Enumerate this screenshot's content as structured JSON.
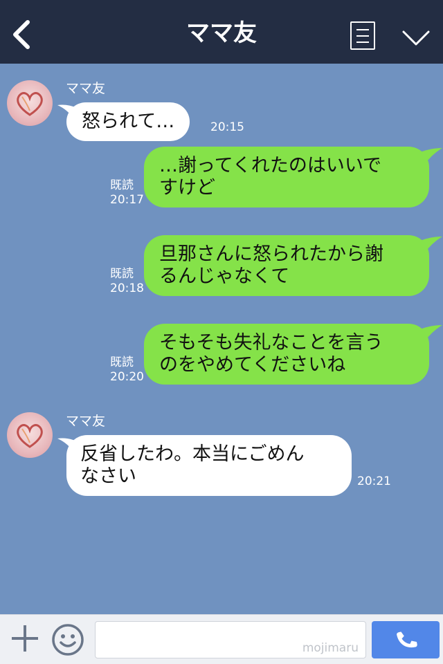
{
  "header": {
    "title": "ママ友"
  },
  "messages": [
    {
      "sender": "ママ友",
      "text": "怒られて…",
      "time": "20:15"
    },
    {
      "text": "…謝ってくれたのはいいで\nすけど",
      "read": "既読",
      "time": "20:17"
    },
    {
      "text": "旦那さんに怒られたから謝\nるんじゃなくて",
      "read": "既読",
      "time": "20:18"
    },
    {
      "text": "そもそも失礼なことを言う\nのをやめてくださいね",
      "read": "既読",
      "time": "20:20"
    },
    {
      "sender": "ママ友",
      "text": "反省したわ。本当にごめん\nなさい",
      "time": "20:21"
    }
  ],
  "footer": {
    "watermark": "mojimaru"
  },
  "colors": {
    "header_bg": "#232d43",
    "chat_bg": "#7092c0",
    "outgoing_bubble": "#85e249",
    "incoming_bubble": "#ffffff",
    "call_button": "#5287e8"
  }
}
